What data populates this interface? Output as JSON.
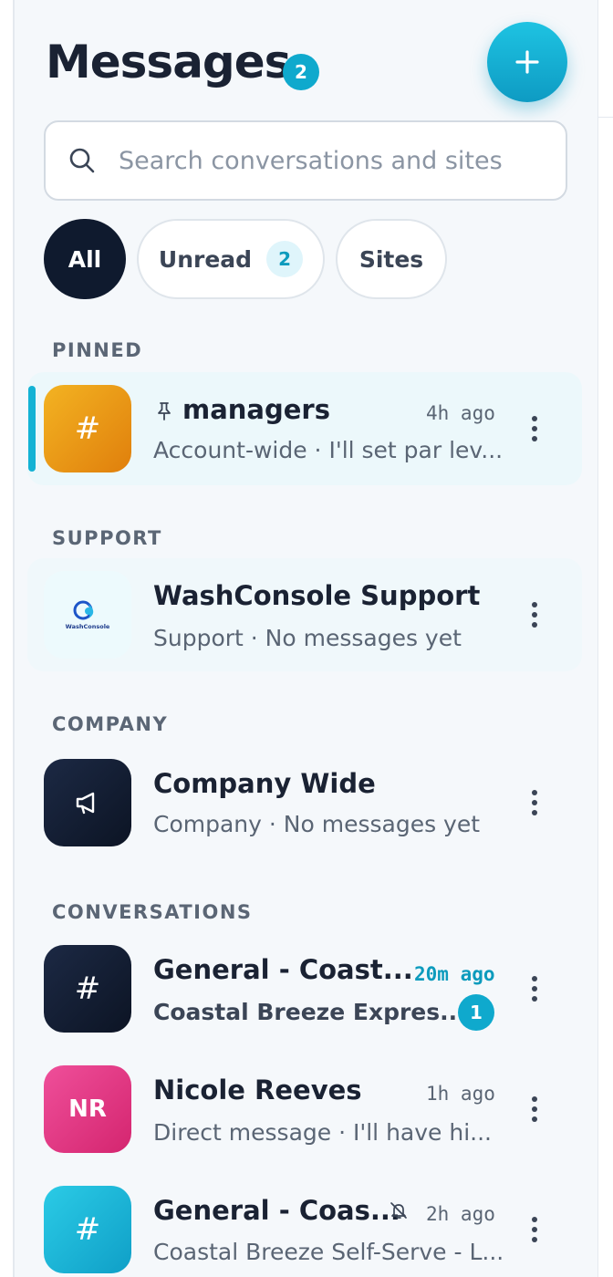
{
  "header": {
    "title": "Messages",
    "unread_total": "2",
    "new_button_icon": "plus-icon"
  },
  "search": {
    "placeholder": "Search conversations and sites",
    "icon": "search-icon"
  },
  "filters": {
    "all": "All",
    "unread": "Unread",
    "unread_count": "2",
    "sites": "Sites",
    "active": "All"
  },
  "sections": {
    "pinned": "PINNED",
    "support": "SUPPORT",
    "company": "COMPANY",
    "conversations": "CONVERSATIONS"
  },
  "pinned": [
    {
      "name": "managers",
      "preview": "Account-wide · I'll set par lev...",
      "time": "4h ago",
      "icon": "pin-icon",
      "avatar": "#"
    }
  ],
  "support": [
    {
      "name": "WashConsole Support",
      "preview": "Support · No messages yet",
      "avatar_text": "WashConsole"
    }
  ],
  "company": [
    {
      "name": "Company Wide",
      "preview": "Company · No messages yet",
      "avatar": "megaphone-icon"
    }
  ],
  "conversations": [
    {
      "name": "General - Coast...",
      "preview": "Coastal Breeze Expres...",
      "time": "20m ago",
      "unread": "1",
      "avatar": "#"
    },
    {
      "name": "Nicole Reeves",
      "preview": "Direct message · I'll have hi...",
      "time": "1h ago",
      "avatar": "NR"
    },
    {
      "name": "General - Coas...",
      "preview": "Coastal Breeze Self-Serve - L...",
      "time": "2h ago",
      "muted_icon": "bell-off-icon",
      "avatar": "#"
    }
  ],
  "colors": {
    "accent": "#0fa9cd",
    "dark": "#0f1a2e",
    "pinned_orange": "#f3b322",
    "pink": "#e0367f"
  }
}
